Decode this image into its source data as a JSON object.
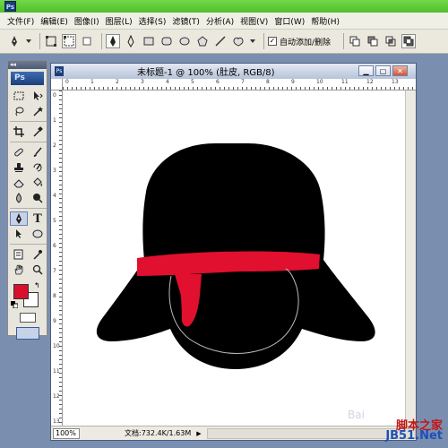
{
  "app": {
    "icon_label": "Ps"
  },
  "menu": {
    "items": [
      "文件(F)",
      "编辑(E)",
      "图像(I)",
      "图层(L)",
      "选择(S)",
      "滤镜(T)",
      "分析(A)",
      "视图(V)",
      "窗口(W)",
      "帮助(H)"
    ]
  },
  "options": {
    "auto_add_delete_label": "自动添加/删除",
    "auto_add_delete_checked": true
  },
  "toolbox": {
    "logo": "Ps",
    "foreground_color": "#d9102c",
    "background_color": "#ffffff"
  },
  "document": {
    "title": "未标题-1 @ 100% (肚皮, RGB/8)",
    "zoom": "100%",
    "doc_info": "文档:732.4K/1.63M",
    "ruler_top_labels": [
      "0",
      "1",
      "2",
      "3",
      "4",
      "5",
      "6",
      "7",
      "8",
      "9",
      "10",
      "11",
      "12",
      "13"
    ],
    "ruler_left_labels": [
      "0",
      "1",
      "2",
      "3",
      "4",
      "5",
      "6",
      "7",
      "8",
      "9",
      "10",
      "11",
      "12",
      "13"
    ]
  },
  "artwork": {
    "body_color": "#000000",
    "band_color": "#e0102e",
    "path_color": "#bbbbbb"
  },
  "watermark": {
    "line1": "脚本之家",
    "line2": "JB51.Net",
    "baidu": "Bai"
  }
}
